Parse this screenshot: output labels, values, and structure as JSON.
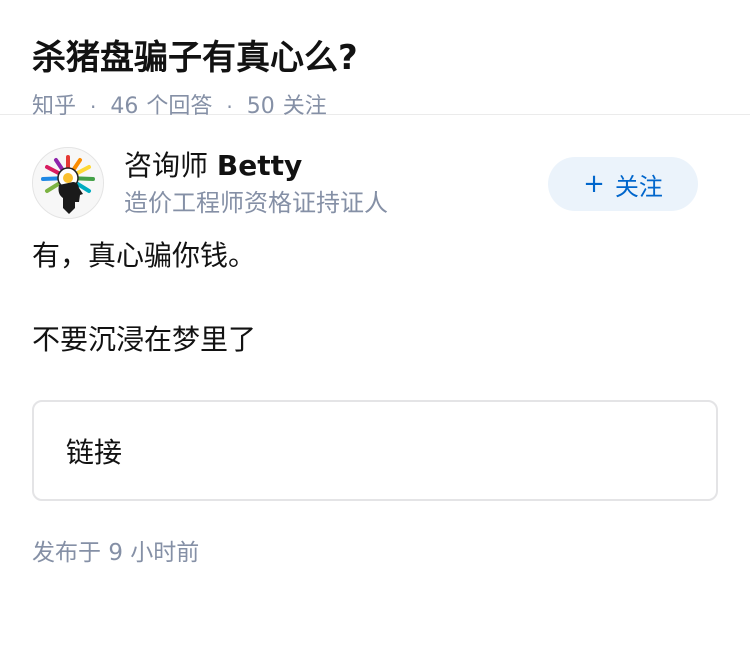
{
  "question": {
    "title": "杀猪盘骗子有真心么?",
    "source": "知乎",
    "separator": "·",
    "answer_count": "46",
    "answer_label": "个回答",
    "follower_count": "50",
    "follower_label": "关注"
  },
  "author": {
    "name_cn": "咨询师",
    "name_en": "Betty",
    "bio": "造价工程师资格证持证人",
    "avatar_icon": "colorful-brain-head-icon",
    "follow_label": "关注",
    "follow_icon": "plus-icon"
  },
  "answer": {
    "paragraphs": [
      "有，真心骗你钱。",
      "不要沉浸在梦里了"
    ],
    "link_card_label": "链接",
    "publish_prefix": "发布于",
    "publish_time": "9 小时前"
  },
  "colors": {
    "accent": "#0066cc",
    "follow_bg": "#ebf3fb",
    "meta_gray": "#8590a6",
    "text": "#121212"
  }
}
